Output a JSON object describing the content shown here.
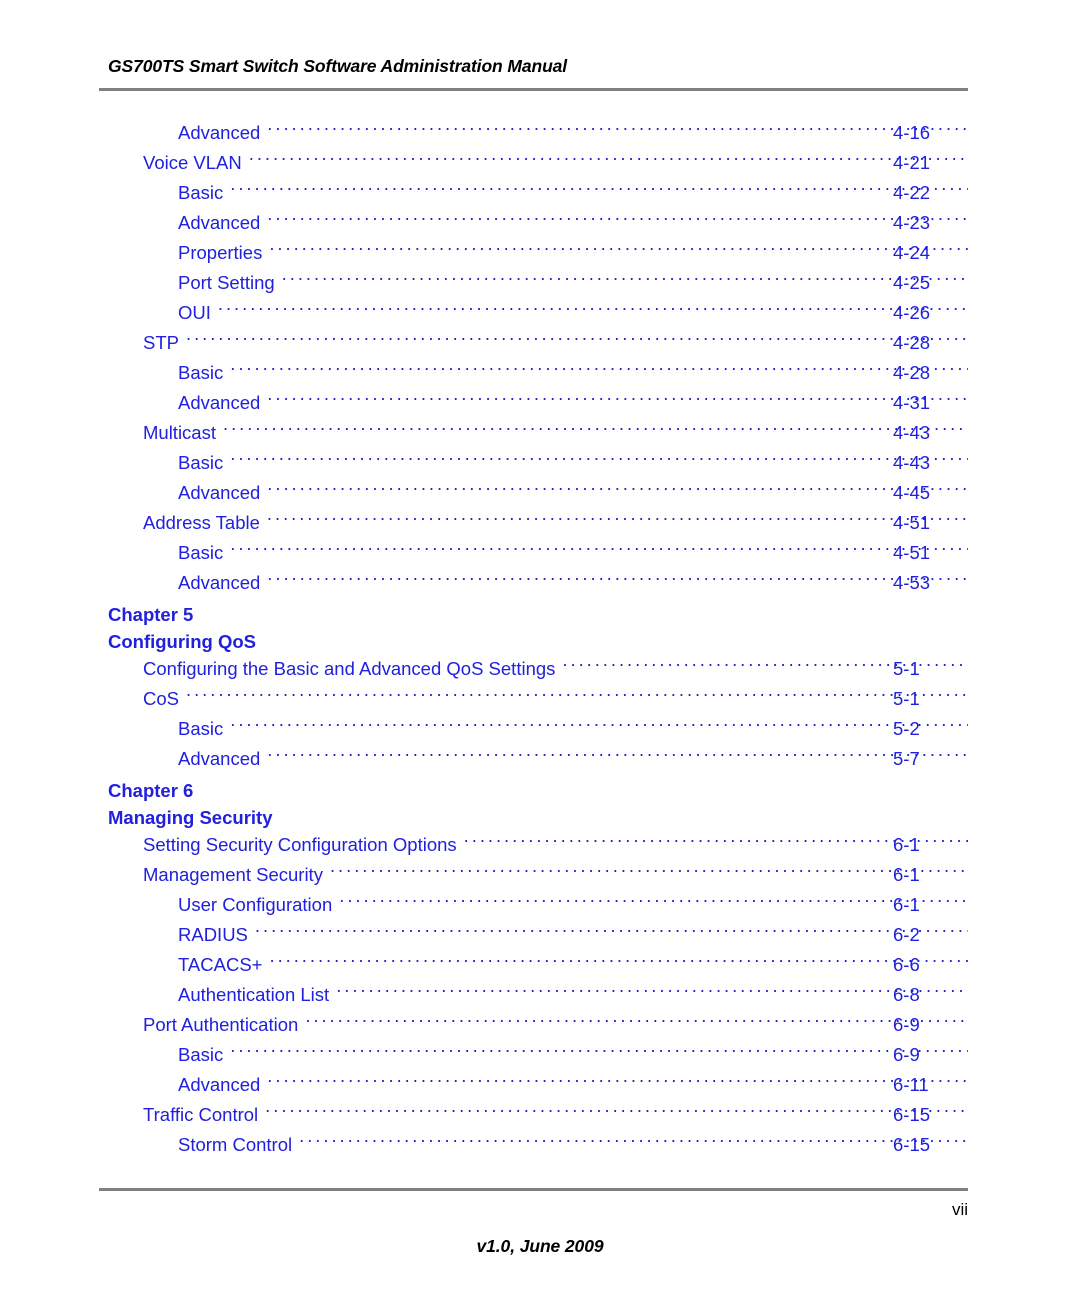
{
  "header": {
    "title": "GS700TS Smart Switch Software Administration Manual"
  },
  "footer": {
    "page_number": "vii",
    "version": "v1.0, June 2009"
  },
  "colors": {
    "toc_link": "#2020DE",
    "rule": "#808080",
    "text": "#000000"
  },
  "toc": {
    "blocks": [
      {
        "type": "entries",
        "entries": [
          {
            "label": "Advanced",
            "page": "4-16",
            "level": 2
          },
          {
            "label": "Voice VLAN",
            "page": "4-21",
            "level": 1
          },
          {
            "label": "Basic",
            "page": "4-22",
            "level": 2
          },
          {
            "label": "Advanced",
            "page": "4-23",
            "level": 2
          },
          {
            "label": "Properties",
            "page": "4-24",
            "level": 2
          },
          {
            "label": "Port Setting",
            "page": "4-25",
            "level": 2
          },
          {
            "label": "OUI",
            "page": "4-26",
            "level": 2
          },
          {
            "label": "STP",
            "page": "4-28",
            "level": 1
          },
          {
            "label": "Basic",
            "page": "4-28",
            "level": 2
          },
          {
            "label": "Advanced",
            "page": "4-31",
            "level": 2
          },
          {
            "label": "Multicast",
            "page": "4-43",
            "level": 1
          },
          {
            "label": "Basic",
            "page": "4-43",
            "level": 2
          },
          {
            "label": "Advanced",
            "page": "4-45",
            "level": 2
          },
          {
            "label": "Address Table",
            "page": "4-51",
            "level": 1
          },
          {
            "label": "Basic",
            "page": "4-51",
            "level": 2
          },
          {
            "label": "Advanced",
            "page": "4-53",
            "level": 2
          }
        ]
      },
      {
        "type": "chapter",
        "chapter_label": "Chapter 5",
        "chapter_title": "Configuring QoS",
        "entries": [
          {
            "label": "Configuring the Basic and Advanced QoS Settings",
            "page": "5-1",
            "level": 1
          },
          {
            "label": "CoS",
            "page": "5-1",
            "level": 1
          },
          {
            "label": "Basic",
            "page": "5-2",
            "level": 2
          },
          {
            "label": "Advanced",
            "page": "5-7",
            "level": 2
          }
        ]
      },
      {
        "type": "chapter",
        "chapter_label": "Chapter 6",
        "chapter_title": "Managing Security",
        "entries": [
          {
            "label": "Setting Security Configuration Options",
            "page": "6-1",
            "level": 1
          },
          {
            "label": "Management Security",
            "page": "6-1",
            "level": 1
          },
          {
            "label": "User Configuration",
            "page": "6-1",
            "level": 2
          },
          {
            "label": "RADIUS",
            "page": "6-2",
            "level": 2
          },
          {
            "label": "TACACS+",
            "page": "6-6",
            "level": 2
          },
          {
            "label": "Authentication List",
            "page": "6-8",
            "level": 2
          },
          {
            "label": "Port Authentication",
            "page": "6-9",
            "level": 1
          },
          {
            "label": "Basic",
            "page": "6-9",
            "level": 2
          },
          {
            "label": "Advanced",
            "page": "6-11",
            "level": 2
          },
          {
            "label": "Traffic Control",
            "page": "6-15",
            "level": 1
          },
          {
            "label": "Storm Control",
            "page": "6-15",
            "level": 2
          }
        ]
      }
    ]
  }
}
